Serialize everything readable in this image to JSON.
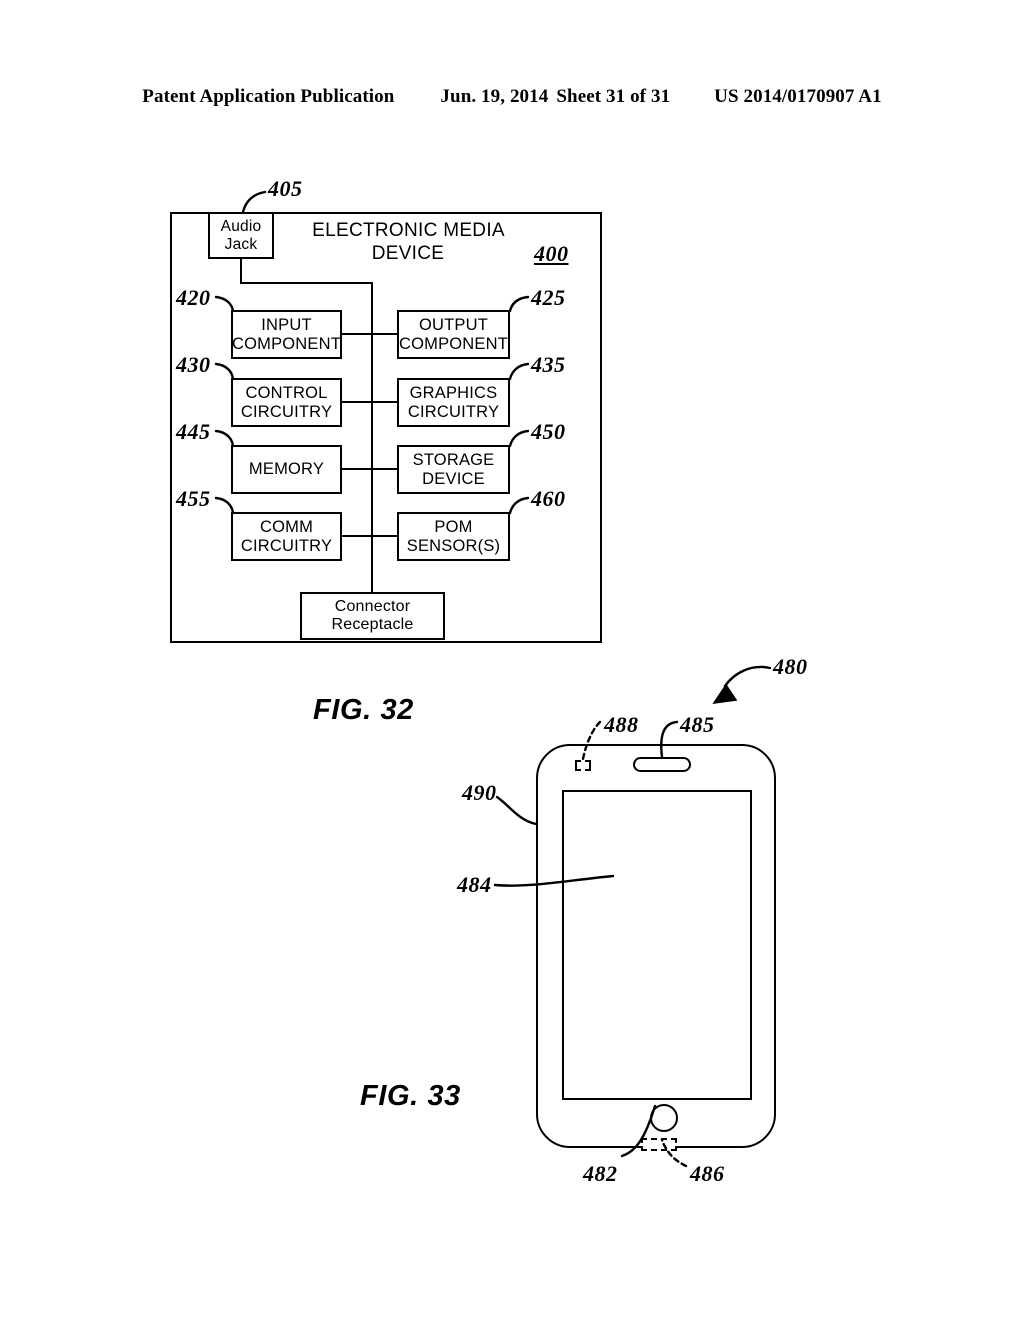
{
  "header": {
    "publication": "Patent Application Publication",
    "date": "Jun. 19, 2014",
    "sheet": "Sheet 31 of 31",
    "patent_number": "US 2014/0170907 A1"
  },
  "fig32": {
    "caption": "FIG. 32",
    "device_title_line1": "ELECTRONIC MEDIA",
    "device_title_line2": "DEVICE",
    "device_ref": "400",
    "blocks": [
      {
        "id": "audio-jack",
        "line1": "Audio",
        "line2": "Jack",
        "ref": "405"
      },
      {
        "id": "input",
        "line1": "INPUT",
        "line2": "COMPONENT",
        "ref": "420"
      },
      {
        "id": "output",
        "line1": "OUTPUT",
        "line2": "COMPONENT",
        "ref": "425"
      },
      {
        "id": "control",
        "line1": "CONTROL",
        "line2": "CIRCUITRY",
        "ref": "430"
      },
      {
        "id": "graphics",
        "line1": "GRAPHICS",
        "line2": "CIRCUITRY",
        "ref": "435"
      },
      {
        "id": "memory",
        "line1": "MEMORY",
        "line2": "",
        "ref": "445"
      },
      {
        "id": "storage",
        "line1": "STORAGE",
        "line2": "DEVICE",
        "ref": "450"
      },
      {
        "id": "comm",
        "line1": "COMM",
        "line2": "CIRCUITRY",
        "ref": "455"
      },
      {
        "id": "pom",
        "line1": "POM",
        "line2": "SENSOR(S)",
        "ref": "460"
      },
      {
        "id": "connector",
        "line1": "Connector",
        "line2": "Receptacle",
        "ref": ""
      }
    ]
  },
  "fig33": {
    "caption": "FIG. 33",
    "refs": {
      "device": "480",
      "home_button": "482",
      "display": "484",
      "earpiece_speaker": "485",
      "connector_receptacle": "486",
      "sensor_opening": "488",
      "housing_bezel": "490"
    }
  },
  "colors": {
    "ink": "#000000",
    "paper": "#ffffff"
  }
}
